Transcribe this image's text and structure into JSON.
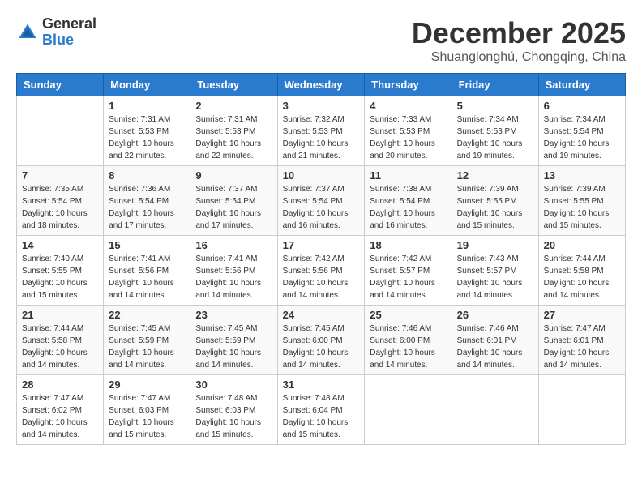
{
  "header": {
    "logo_general": "General",
    "logo_blue": "Blue",
    "month": "December 2025",
    "location": "Shuanglonghú, Chongqing, China"
  },
  "weekdays": [
    "Sunday",
    "Monday",
    "Tuesday",
    "Wednesday",
    "Thursday",
    "Friday",
    "Saturday"
  ],
  "weeks": [
    [
      {
        "day": "",
        "sunrise": "",
        "sunset": "",
        "daylight": ""
      },
      {
        "day": "1",
        "sunrise": "Sunrise: 7:31 AM",
        "sunset": "Sunset: 5:53 PM",
        "daylight": "Daylight: 10 hours and 22 minutes."
      },
      {
        "day": "2",
        "sunrise": "Sunrise: 7:31 AM",
        "sunset": "Sunset: 5:53 PM",
        "daylight": "Daylight: 10 hours and 22 minutes."
      },
      {
        "day": "3",
        "sunrise": "Sunrise: 7:32 AM",
        "sunset": "Sunset: 5:53 PM",
        "daylight": "Daylight: 10 hours and 21 minutes."
      },
      {
        "day": "4",
        "sunrise": "Sunrise: 7:33 AM",
        "sunset": "Sunset: 5:53 PM",
        "daylight": "Daylight: 10 hours and 20 minutes."
      },
      {
        "day": "5",
        "sunrise": "Sunrise: 7:34 AM",
        "sunset": "Sunset: 5:53 PM",
        "daylight": "Daylight: 10 hours and 19 minutes."
      },
      {
        "day": "6",
        "sunrise": "Sunrise: 7:34 AM",
        "sunset": "Sunset: 5:54 PM",
        "daylight": "Daylight: 10 hours and 19 minutes."
      }
    ],
    [
      {
        "day": "7",
        "sunrise": "Sunrise: 7:35 AM",
        "sunset": "Sunset: 5:54 PM",
        "daylight": "Daylight: 10 hours and 18 minutes."
      },
      {
        "day": "8",
        "sunrise": "Sunrise: 7:36 AM",
        "sunset": "Sunset: 5:54 PM",
        "daylight": "Daylight: 10 hours and 17 minutes."
      },
      {
        "day": "9",
        "sunrise": "Sunrise: 7:37 AM",
        "sunset": "Sunset: 5:54 PM",
        "daylight": "Daylight: 10 hours and 17 minutes."
      },
      {
        "day": "10",
        "sunrise": "Sunrise: 7:37 AM",
        "sunset": "Sunset: 5:54 PM",
        "daylight": "Daylight: 10 hours and 16 minutes."
      },
      {
        "day": "11",
        "sunrise": "Sunrise: 7:38 AM",
        "sunset": "Sunset: 5:54 PM",
        "daylight": "Daylight: 10 hours and 16 minutes."
      },
      {
        "day": "12",
        "sunrise": "Sunrise: 7:39 AM",
        "sunset": "Sunset: 5:55 PM",
        "daylight": "Daylight: 10 hours and 15 minutes."
      },
      {
        "day": "13",
        "sunrise": "Sunrise: 7:39 AM",
        "sunset": "Sunset: 5:55 PM",
        "daylight": "Daylight: 10 hours and 15 minutes."
      }
    ],
    [
      {
        "day": "14",
        "sunrise": "Sunrise: 7:40 AM",
        "sunset": "Sunset: 5:55 PM",
        "daylight": "Daylight: 10 hours and 15 minutes."
      },
      {
        "day": "15",
        "sunrise": "Sunrise: 7:41 AM",
        "sunset": "Sunset: 5:56 PM",
        "daylight": "Daylight: 10 hours and 14 minutes."
      },
      {
        "day": "16",
        "sunrise": "Sunrise: 7:41 AM",
        "sunset": "Sunset: 5:56 PM",
        "daylight": "Daylight: 10 hours and 14 minutes."
      },
      {
        "day": "17",
        "sunrise": "Sunrise: 7:42 AM",
        "sunset": "Sunset: 5:56 PM",
        "daylight": "Daylight: 10 hours and 14 minutes."
      },
      {
        "day": "18",
        "sunrise": "Sunrise: 7:42 AM",
        "sunset": "Sunset: 5:57 PM",
        "daylight": "Daylight: 10 hours and 14 minutes."
      },
      {
        "day": "19",
        "sunrise": "Sunrise: 7:43 AM",
        "sunset": "Sunset: 5:57 PM",
        "daylight": "Daylight: 10 hours and 14 minutes."
      },
      {
        "day": "20",
        "sunrise": "Sunrise: 7:44 AM",
        "sunset": "Sunset: 5:58 PM",
        "daylight": "Daylight: 10 hours and 14 minutes."
      }
    ],
    [
      {
        "day": "21",
        "sunrise": "Sunrise: 7:44 AM",
        "sunset": "Sunset: 5:58 PM",
        "daylight": "Daylight: 10 hours and 14 minutes."
      },
      {
        "day": "22",
        "sunrise": "Sunrise: 7:45 AM",
        "sunset": "Sunset: 5:59 PM",
        "daylight": "Daylight: 10 hours and 14 minutes."
      },
      {
        "day": "23",
        "sunrise": "Sunrise: 7:45 AM",
        "sunset": "Sunset: 5:59 PM",
        "daylight": "Daylight: 10 hours and 14 minutes."
      },
      {
        "day": "24",
        "sunrise": "Sunrise: 7:45 AM",
        "sunset": "Sunset: 6:00 PM",
        "daylight": "Daylight: 10 hours and 14 minutes."
      },
      {
        "day": "25",
        "sunrise": "Sunrise: 7:46 AM",
        "sunset": "Sunset: 6:00 PM",
        "daylight": "Daylight: 10 hours and 14 minutes."
      },
      {
        "day": "26",
        "sunrise": "Sunrise: 7:46 AM",
        "sunset": "Sunset: 6:01 PM",
        "daylight": "Daylight: 10 hours and 14 minutes."
      },
      {
        "day": "27",
        "sunrise": "Sunrise: 7:47 AM",
        "sunset": "Sunset: 6:01 PM",
        "daylight": "Daylight: 10 hours and 14 minutes."
      }
    ],
    [
      {
        "day": "28",
        "sunrise": "Sunrise: 7:47 AM",
        "sunset": "Sunset: 6:02 PM",
        "daylight": "Daylight: 10 hours and 14 minutes."
      },
      {
        "day": "29",
        "sunrise": "Sunrise: 7:47 AM",
        "sunset": "Sunset: 6:03 PM",
        "daylight": "Daylight: 10 hours and 15 minutes."
      },
      {
        "day": "30",
        "sunrise": "Sunrise: 7:48 AM",
        "sunset": "Sunset: 6:03 PM",
        "daylight": "Daylight: 10 hours and 15 minutes."
      },
      {
        "day": "31",
        "sunrise": "Sunrise: 7:48 AM",
        "sunset": "Sunset: 6:04 PM",
        "daylight": "Daylight: 10 hours and 15 minutes."
      },
      {
        "day": "",
        "sunrise": "",
        "sunset": "",
        "daylight": ""
      },
      {
        "day": "",
        "sunrise": "",
        "sunset": "",
        "daylight": ""
      },
      {
        "day": "",
        "sunrise": "",
        "sunset": "",
        "daylight": ""
      }
    ]
  ]
}
